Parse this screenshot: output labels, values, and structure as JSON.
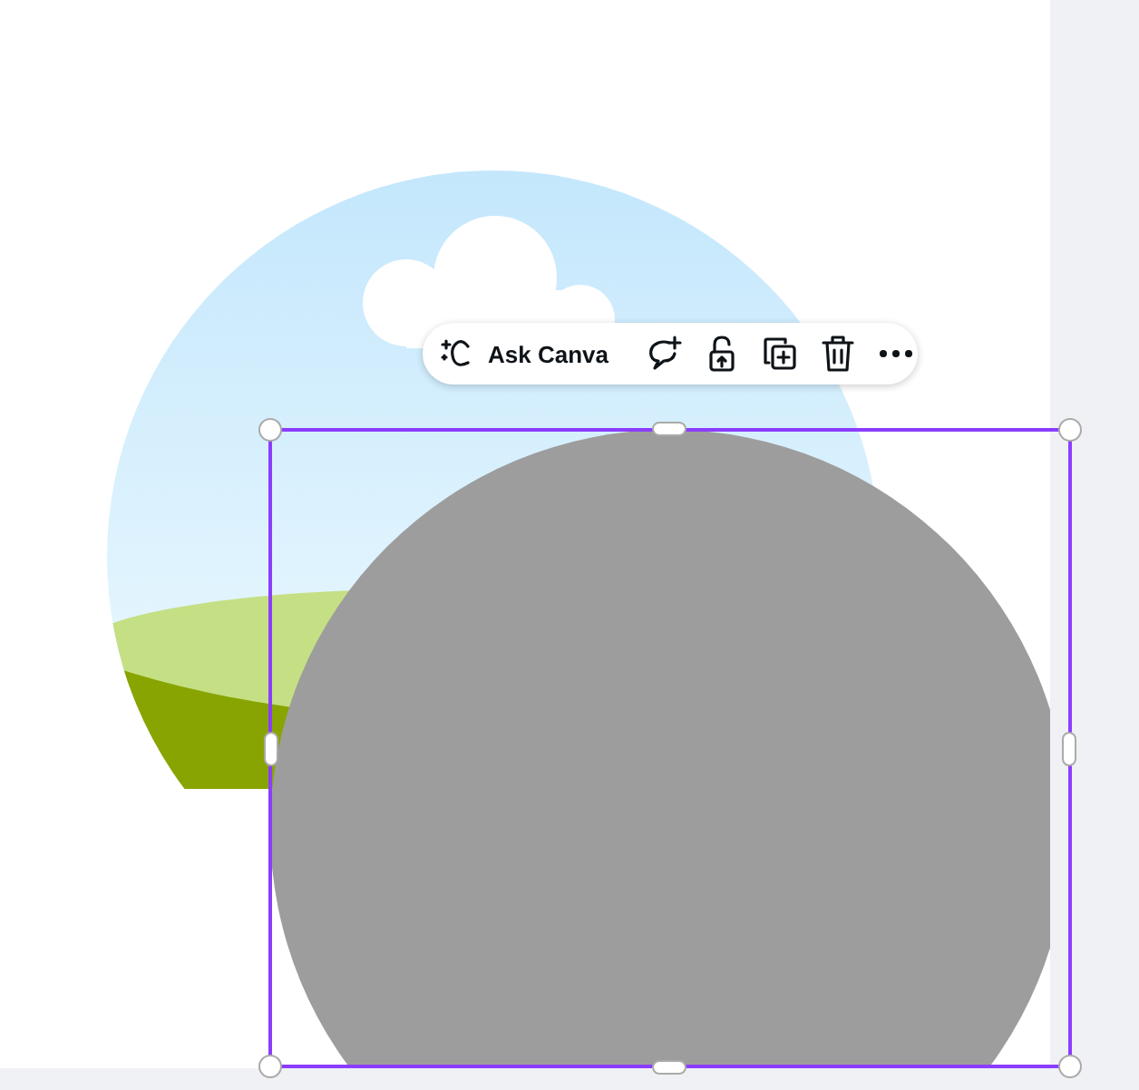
{
  "toolbar": {
    "ask_label": "Ask Canva"
  }
}
